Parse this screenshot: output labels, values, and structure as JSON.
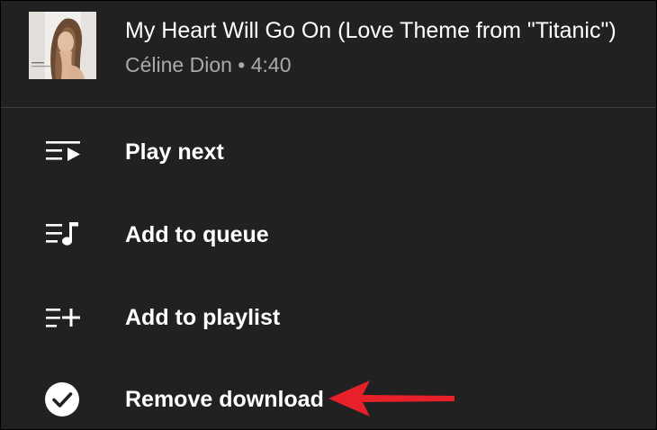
{
  "track": {
    "title": "My Heart Will Go On (Love Theme from \"Titanic\")",
    "artist": "Céline Dion",
    "separator": "•",
    "duration": "4:40",
    "subtitle": "Céline Dion • 4:40"
  },
  "menu": {
    "items": [
      {
        "label": "Play next",
        "icon": "play-next-icon"
      },
      {
        "label": "Add to queue",
        "icon": "add-to-queue-icon"
      },
      {
        "label": "Add to playlist",
        "icon": "add-to-playlist-icon"
      },
      {
        "label": "Remove download",
        "icon": "downloaded-check-icon"
      }
    ]
  },
  "annotation": {
    "arrow_color": "#e8202a"
  },
  "colors": {
    "background": "#212121",
    "text_primary": "#ffffff",
    "text_secondary": "#aaaaaa",
    "divider": "#3e3e3e"
  }
}
